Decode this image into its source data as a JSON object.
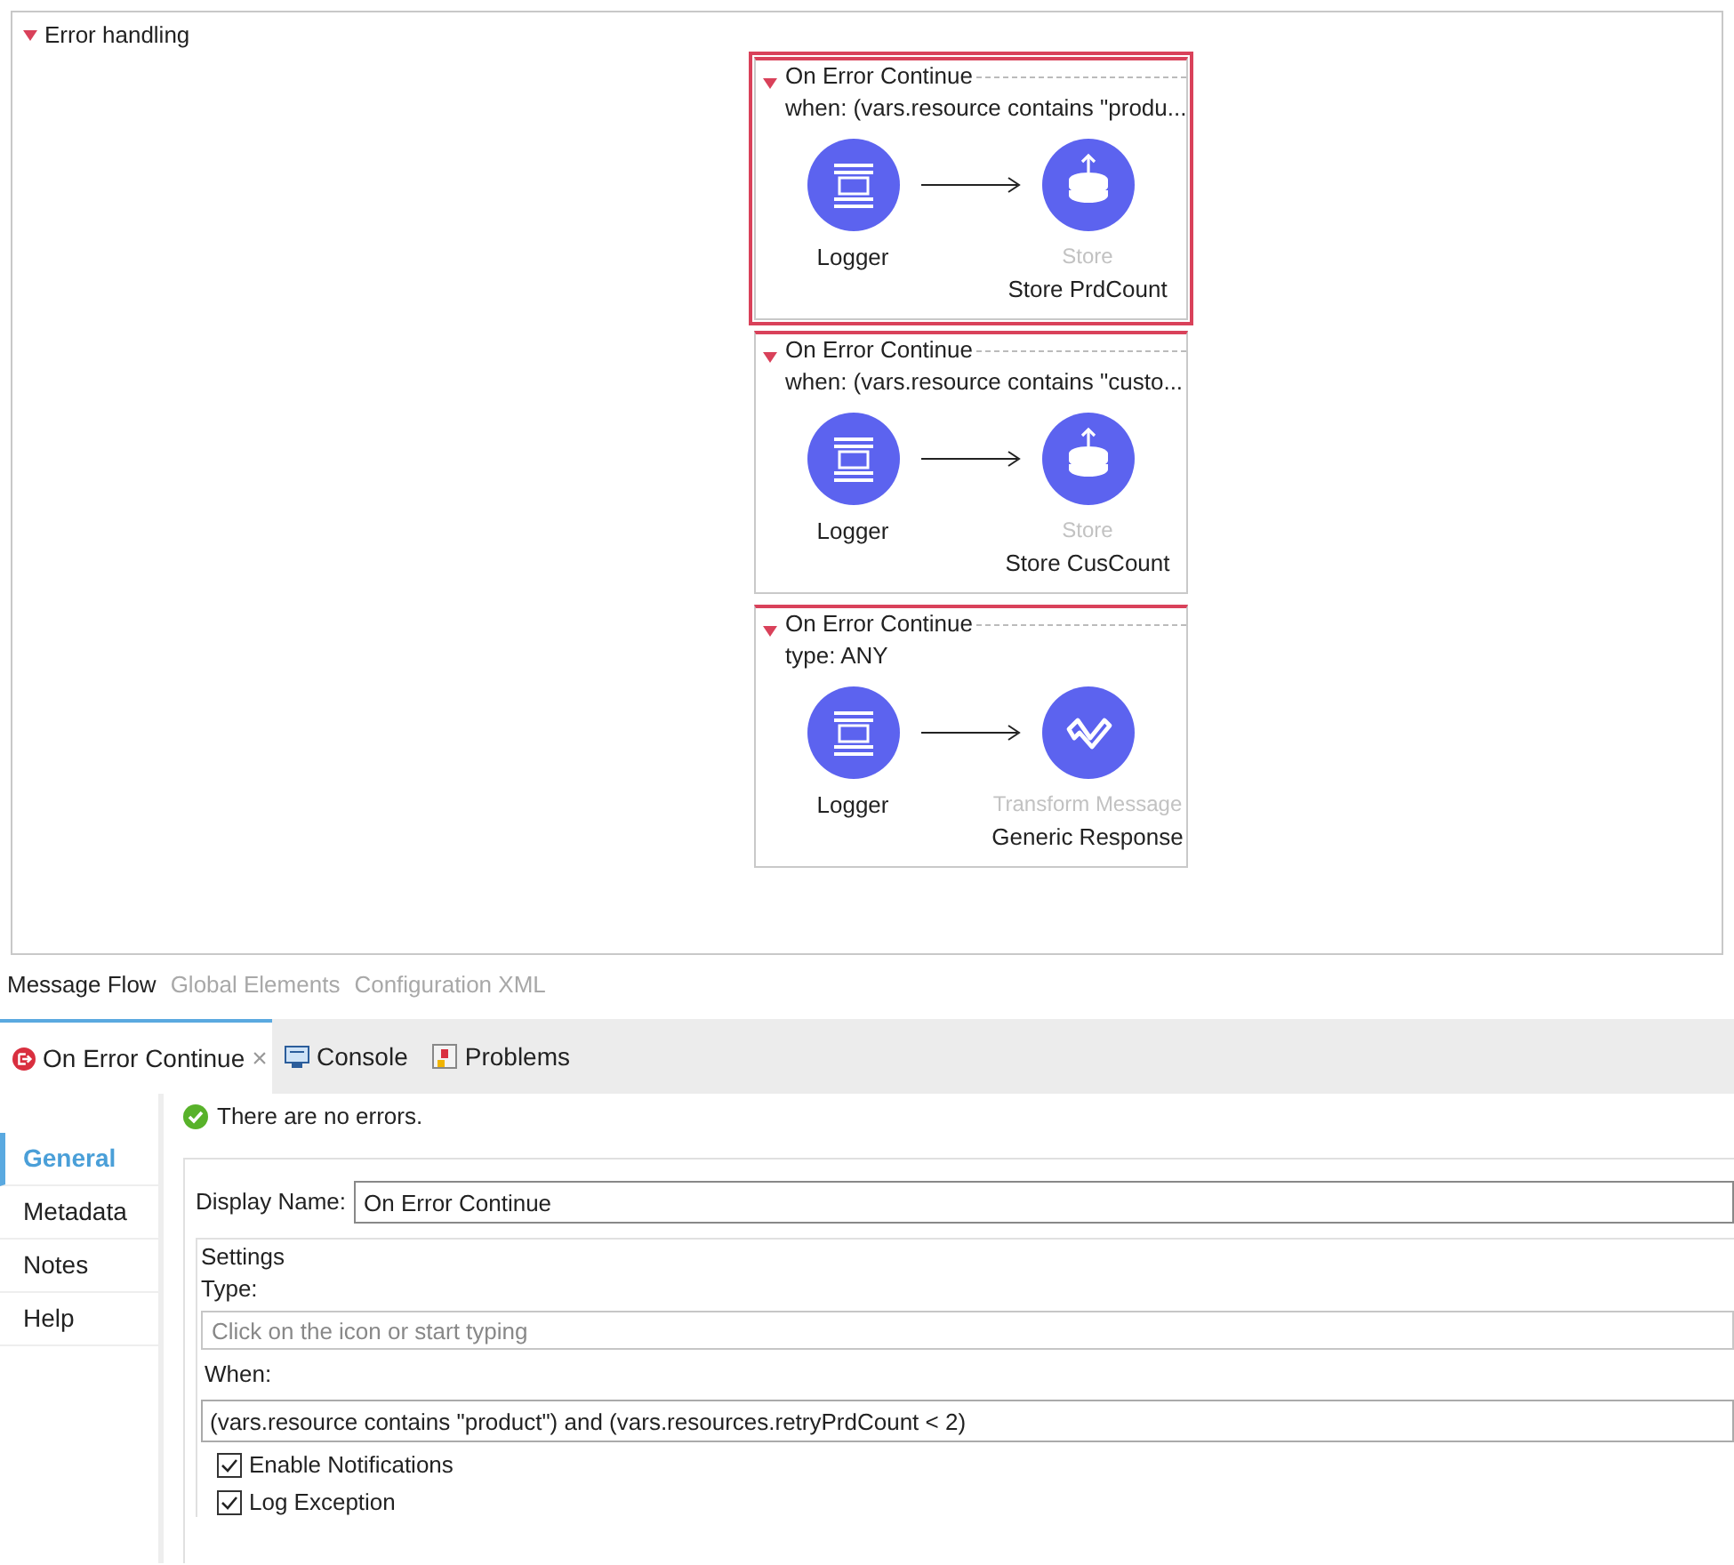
{
  "section": {
    "title": "Error handling",
    "expanded": true
  },
  "scopes": [
    {
      "title": "On Error Continue",
      "condition": "when: (vars.resource contains \"produ...",
      "selected": true,
      "steps": [
        {
          "kind": "logger",
          "label": "Logger"
        },
        {
          "kind": "store",
          "type_label": "Store",
          "label": "Store PrdCount"
        }
      ]
    },
    {
      "title": "On Error Continue",
      "condition": "when: (vars.resource contains \"custo...",
      "selected": false,
      "steps": [
        {
          "kind": "logger",
          "label": "Logger"
        },
        {
          "kind": "store",
          "type_label": "Store",
          "label": "Store CusCount"
        }
      ]
    },
    {
      "title": "On Error Continue",
      "condition": "type: ANY",
      "selected": false,
      "steps": [
        {
          "kind": "logger",
          "label": "Logger"
        },
        {
          "kind": "transform",
          "type_label": "Transform Message",
          "label": "Generic Response"
        }
      ]
    }
  ],
  "editor_tabs": [
    {
      "label": "Message Flow",
      "selected": true
    },
    {
      "label": "Global Elements",
      "selected": false
    },
    {
      "label": "Configuration XML",
      "selected": false
    }
  ],
  "view_tabs": [
    {
      "kind": "error",
      "label": "On Error Continue",
      "selected": true,
      "close": "×"
    },
    {
      "kind": "console",
      "label": "Console",
      "selected": false
    },
    {
      "kind": "problems",
      "label": "Problems",
      "selected": false
    }
  ],
  "side_tabs": [
    {
      "label": "General",
      "selected": true
    },
    {
      "label": "Metadata",
      "selected": false
    },
    {
      "label": "Notes",
      "selected": false
    },
    {
      "label": "Help",
      "selected": false
    }
  ],
  "status": "There are no errors.",
  "display_name": {
    "label": "Display Name:",
    "value": "On Error Continue"
  },
  "settings": {
    "title": "Settings",
    "type_label": "Type:",
    "type_placeholder": "Click on the icon or start typing",
    "when_label": "When:",
    "when_value": "(vars.resource contains \"product\") and (vars.resources.retryPrdCount < 2)",
    "options": [
      {
        "label": "Enable Notifications",
        "checked": true
      },
      {
        "label": "Log Exception",
        "checked": true
      }
    ]
  }
}
